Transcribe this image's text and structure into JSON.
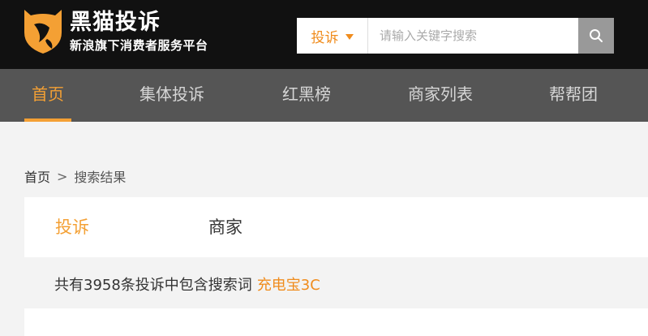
{
  "header": {
    "logo_title": "黑猫投诉",
    "logo_subtitle": "新浪旗下消费者服务平台"
  },
  "search": {
    "type_label": "投诉",
    "placeholder": "请输入关键字搜索"
  },
  "nav": {
    "items": [
      {
        "label": "首页"
      },
      {
        "label": "集体投诉"
      },
      {
        "label": "红黑榜"
      },
      {
        "label": "商家列表"
      },
      {
        "label": "帮帮团"
      }
    ]
  },
  "breadcrumb": {
    "home": "首页",
    "separator": ">",
    "current": "搜索结果"
  },
  "tabs": {
    "items": [
      {
        "label": "投诉"
      },
      {
        "label": "商家"
      }
    ]
  },
  "results": {
    "summary": "共有3958条投诉中包含搜索词",
    "keyword": "充电宝3C"
  },
  "colors": {
    "accent": "#f4a034",
    "header_bg": "#111111",
    "nav_bg": "#555555"
  }
}
